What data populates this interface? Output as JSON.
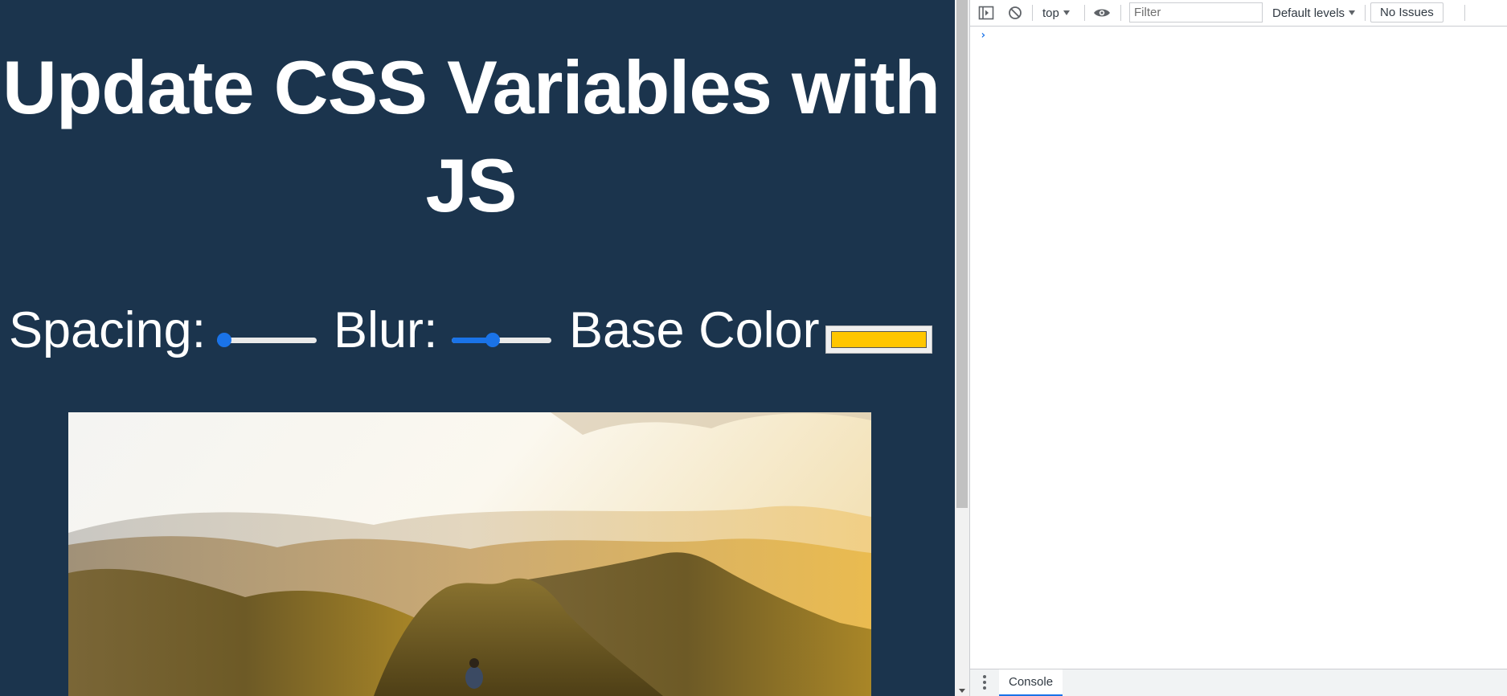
{
  "page": {
    "title": "Update CSS Variables with JS",
    "controls": {
      "spacing": {
        "label": "Spacing:",
        "value_fraction": 0.0
      },
      "blur": {
        "label": "Blur:",
        "value_fraction": 0.4
      },
      "base_color": {
        "label": "Base Color",
        "value": "#ffc600"
      }
    },
    "photo": {
      "subject": "hiker on mountain ridge at sunset"
    }
  },
  "devtools": {
    "toolbar": {
      "context": "top",
      "filter_placeholder": "Filter",
      "levels": "Default levels",
      "issues": "No Issues"
    },
    "drawer": {
      "tab": "Console"
    }
  },
  "colors": {
    "page_background": "#1b344d",
    "accent": "#1a73e8"
  }
}
